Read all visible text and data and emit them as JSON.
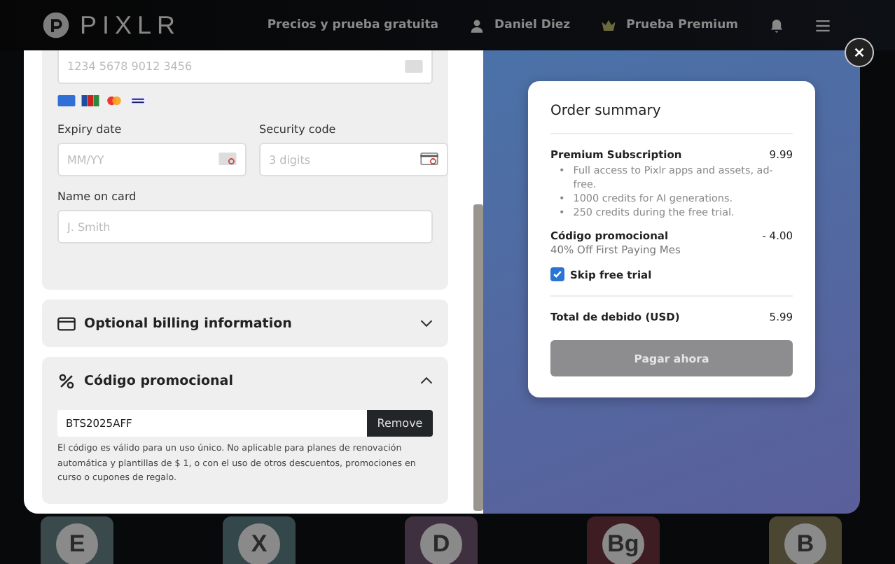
{
  "header": {
    "logo": "PIXLR",
    "nav": [
      {
        "kind": "link",
        "label": "Precios y prueba gratuita"
      },
      {
        "kind": "user",
        "label": "Daniel Diez"
      },
      {
        "kind": "crown",
        "label": "Prueba Premium"
      }
    ]
  },
  "payment": {
    "card_number": {
      "placeholder": "1234 5678 9012 3456"
    },
    "expiry": {
      "label": "Expiry date",
      "placeholder": "MM/YY"
    },
    "security": {
      "label": "Security code",
      "placeholder": "3 digits"
    },
    "name": {
      "label": "Name on card",
      "placeholder": "J. Smith"
    }
  },
  "billing": {
    "title": "Optional billing information",
    "expanded": false
  },
  "promo": {
    "title": "Código promocional",
    "expanded": true,
    "value": "BTS2025AFF",
    "button": "Remove",
    "note": "El código es válido para un uso único. No aplicable para planes de renovación automática y plantillas de $ 1, o con el uso de otros descuentos, promociones en curso o cupones de regalo."
  },
  "summary": {
    "title": "Order summary",
    "items": [
      {
        "name": "Premium Subscription",
        "amount": "9.99",
        "marker": "•",
        "bullets": [
          "Full access to Pixlr apps and assets, ad-free.",
          "1000 credits for AI generations.",
          "250 credits during the free trial."
        ]
      },
      {
        "name": "Código promocional",
        "amount": "- 4.00",
        "sub": "40% Off First Paying Mes"
      }
    ],
    "skip_trial": {
      "label": "Skip free trial",
      "checked": true
    },
    "total": {
      "label": "Total de debido (USD)",
      "amount": "5.99"
    },
    "pay_button": {
      "label": "Pagar ahora",
      "disabled": true
    }
  },
  "apps": [
    {
      "letter": "E",
      "color": "#3a4a4c"
    },
    {
      "letter": "X",
      "color": "#34484c"
    },
    {
      "letter": "D",
      "color": "#3f3040"
    },
    {
      "letter": "Bg",
      "color": "#3d1c22"
    },
    {
      "letter": "B",
      "color": "#4a4632"
    }
  ]
}
